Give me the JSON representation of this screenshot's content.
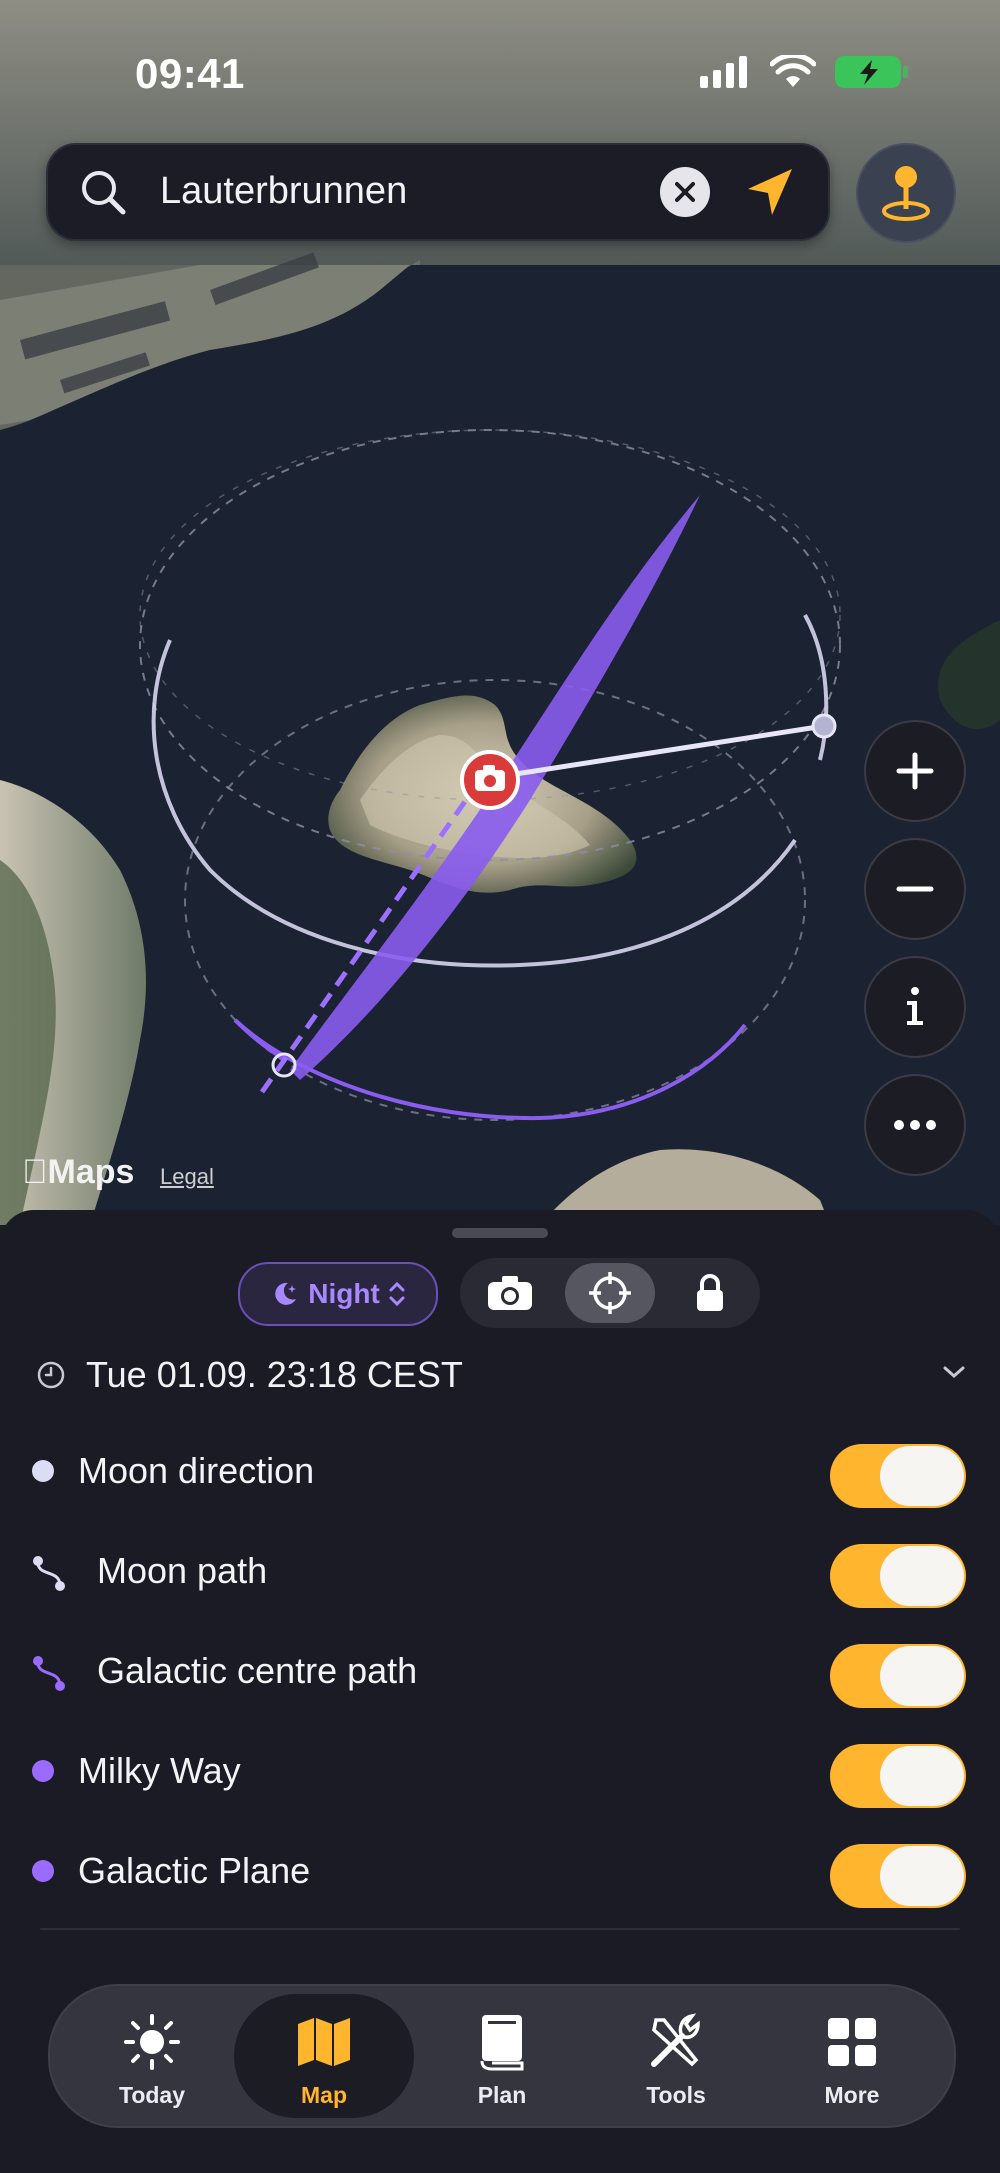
{
  "status": {
    "time": "09:41"
  },
  "search": {
    "query": "Lauterbrunnen"
  },
  "map": {
    "maps_brand": "Maps",
    "legal": "Legal"
  },
  "panel": {
    "mode": "Night",
    "datetime": "Tue 01.09. 23:18  CEST",
    "layers": [
      {
        "label": "Moon direction",
        "on": true
      },
      {
        "label": "Moon path",
        "on": true
      },
      {
        "label": "Galactic centre path",
        "on": true
      },
      {
        "label": "Milky Way",
        "on": true
      },
      {
        "label": "Galactic Plane",
        "on": true
      }
    ]
  },
  "tabs": [
    {
      "label": "Today",
      "icon": "sun-icon"
    },
    {
      "label": "Map",
      "icon": "map-icon",
      "active": true
    },
    {
      "label": "Plan",
      "icon": "book-icon"
    },
    {
      "label": "Tools",
      "icon": "tools-icon"
    },
    {
      "label": "More",
      "icon": "grid-icon"
    }
  ],
  "colors": {
    "accent": "#ffb52e",
    "purple": "#8a5cf0",
    "moon": "#dcdcf5",
    "marker": "#d93a3a"
  }
}
